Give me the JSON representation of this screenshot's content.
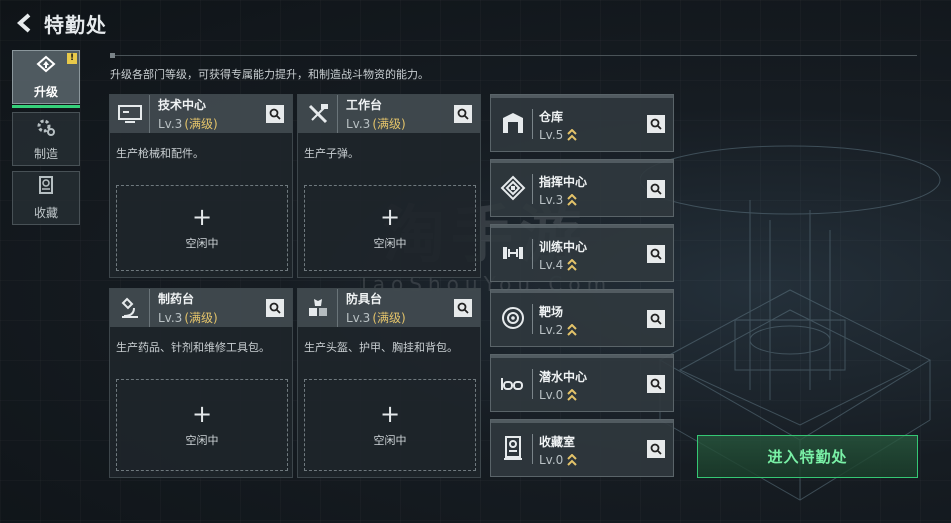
{
  "header": {
    "title": "特勤处"
  },
  "description": "升级各部门等级，可获得专属能力提升，和制造战斗物资的能力。",
  "tabs": [
    {
      "label": "升级",
      "icon": "upgrade-icon",
      "active": true,
      "alert": "!"
    },
    {
      "label": "制造",
      "icon": "gear-icon",
      "active": false
    },
    {
      "label": "收藏",
      "icon": "collection-icon",
      "active": false
    }
  ],
  "departments": [
    {
      "name": "技术中心",
      "level": "Lv.3",
      "max": "(满级)",
      "description": "生产枪械和配件。",
      "slot": "空闲中",
      "icon": "monitor-icon"
    },
    {
      "name": "工作台",
      "level": "Lv.3",
      "max": "(满级)",
      "description": "生产子弹。",
      "slot": "空闲中",
      "icon": "tools-icon"
    },
    {
      "name": "制药台",
      "level": "Lv.3",
      "max": "(满级)",
      "description": "生产药品、针剂和维修工具包。",
      "slot": "空闲中",
      "icon": "microscope-icon"
    },
    {
      "name": "防具台",
      "level": "Lv.3",
      "max": "(满级)",
      "description": "生产头盔、护甲、胸挂和背包。",
      "slot": "空闲中",
      "icon": "armor-icon"
    }
  ],
  "facilities": [
    {
      "name": "仓库",
      "level": "Lv.5",
      "icon": "warehouse-icon"
    },
    {
      "name": "指挥中心",
      "level": "Lv.3",
      "icon": "command-icon"
    },
    {
      "name": "训练中心",
      "level": "Lv.4",
      "icon": "dumbbell-icon"
    },
    {
      "name": "靶场",
      "level": "Lv.2",
      "icon": "target-icon"
    },
    {
      "name": "潜水中心",
      "level": "Lv.0",
      "icon": "goggles-icon"
    },
    {
      "name": "收藏室",
      "level": "Lv.0",
      "icon": "collection-room-icon"
    }
  ],
  "enter_button": "进入特勤处",
  "watermark": {
    "main": "淘手游",
    "sub": "TaoShouYou.Com"
  },
  "colors": {
    "accent_green": "#36d07a",
    "max_level": "#e3c36a",
    "alert": "#e8c94a"
  }
}
